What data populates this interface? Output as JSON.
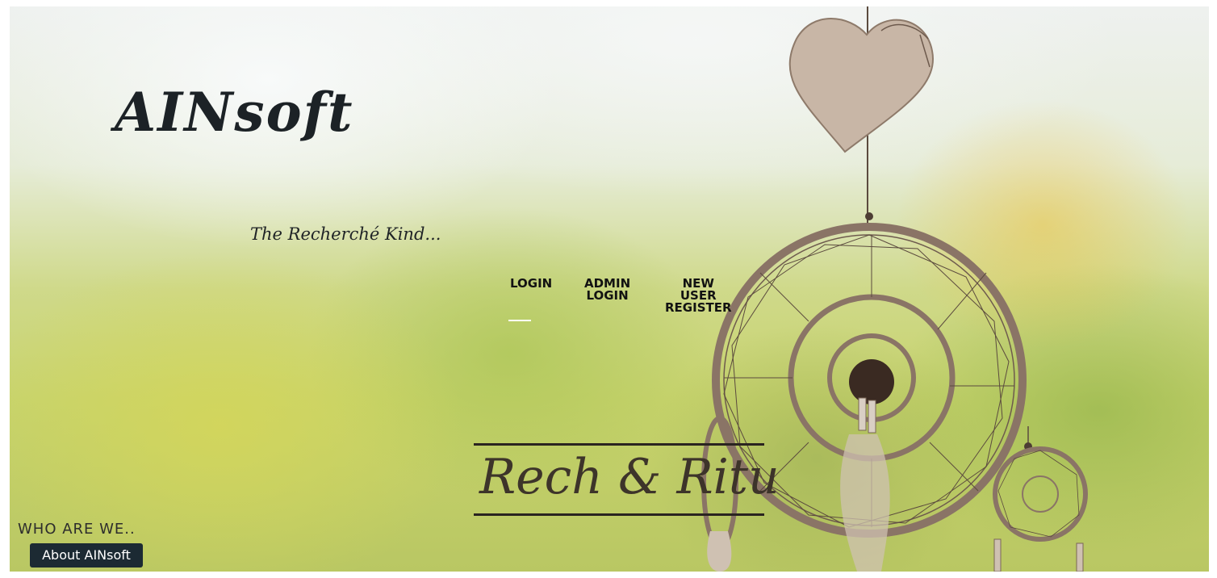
{
  "brand": {
    "logo": "AINsoft",
    "tagline": "The Recherché Kind...",
    "signature": "Rech & Ritu"
  },
  "nav": {
    "login": [
      "LOGIN"
    ],
    "admin_login": [
      "ADMIN",
      "LOGIN"
    ],
    "new_user_register": [
      "NEW",
      "USER",
      "REGISTER"
    ]
  },
  "about": {
    "heading": "WHO ARE WE..",
    "button_label": "About AINsoft"
  },
  "decor_icons": [
    "heart-ornament-icon",
    "dreamcatcher-large-icon",
    "dreamcatcher-small-icon"
  ],
  "colors": {
    "text_dark": "#1c2226",
    "button_bg": "#1c2a33",
    "button_text": "#ffffff",
    "dreamcatcher": "#8a7466"
  }
}
